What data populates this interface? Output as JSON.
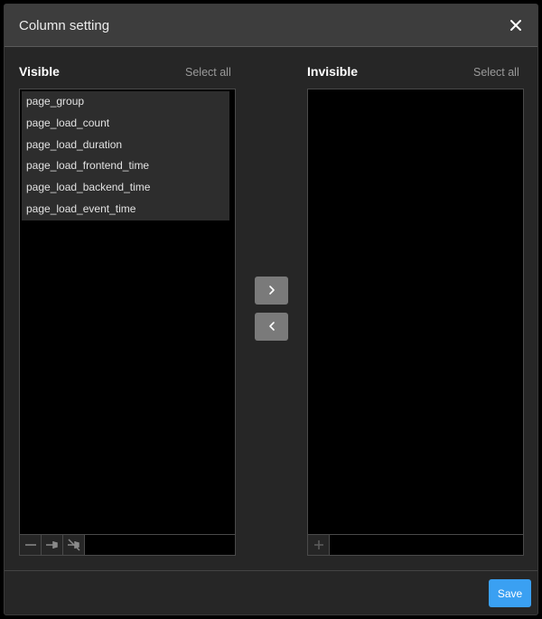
{
  "dialog": {
    "title": "Column setting",
    "close_icon": "close-icon"
  },
  "visible_panel": {
    "title": "Visible",
    "select_all_label": "Select all",
    "items": [
      {
        "label": "page_group"
      },
      {
        "label": "page_load_count"
      },
      {
        "label": "page_load_duration"
      },
      {
        "label": "page_load_frontend_time"
      },
      {
        "label": "page_load_backend_time"
      },
      {
        "label": "page_load_event_time"
      }
    ],
    "toolbar_icons": [
      "minus-icon",
      "pin-icon",
      "unpin-icon"
    ]
  },
  "invisible_panel": {
    "title": "Invisible",
    "select_all_label": "Select all",
    "items": [],
    "toolbar_icons": [
      "plus-icon"
    ]
  },
  "transfer": {
    "move_right_icon": "chevron-right-icon",
    "move_left_icon": "chevron-left-icon"
  },
  "footer": {
    "save_label": "Save"
  },
  "colors": {
    "dialog_bg": "#262626",
    "header_bg": "#3d3d3d",
    "list_bg": "#000000",
    "item_bg": "#2d2d2d",
    "transfer_button_bg": "#7a7a7a",
    "primary_button_bg": "#3aa0f2"
  }
}
